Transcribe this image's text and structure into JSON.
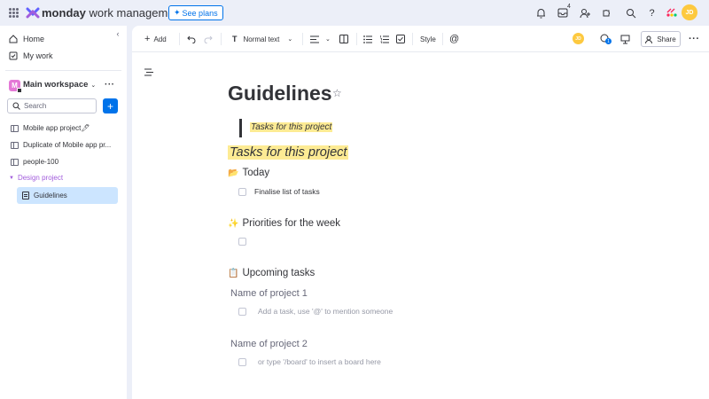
{
  "app": {
    "brand_bold": "monday",
    "brand_rest": " work management",
    "see_plans": "See plans",
    "inbox_count": "4",
    "avatar_initials": "JD"
  },
  "sidebar": {
    "home": "Home",
    "my_work": "My work",
    "workspace_initial": "M",
    "workspace_name": "Main workspace",
    "search_placeholder": "Search",
    "boards": [
      {
        "label": "Mobile app project🖊"
      },
      {
        "label": "Duplicate of Mobile app pr..."
      },
      {
        "label": "people-100"
      }
    ],
    "folder": "Design project",
    "selected_doc": "Guidelines"
  },
  "toolbar": {
    "add": "Add",
    "text_style": "Normal text",
    "style": "Style",
    "share": "Share",
    "avatar_initials": "JD",
    "updates_count": "1"
  },
  "doc": {
    "title": "Guidelines",
    "quote": "Tasks for this project",
    "heading": "Tasks for this project",
    "sections": [
      {
        "emoji": "📂",
        "title": "Today"
      },
      {
        "emoji": "✨",
        "title": "Priorities for the week"
      },
      {
        "emoji": "📋",
        "title": "Upcoming tasks"
      }
    ],
    "today_task": "Finalise list of tasks",
    "project1": "Name of project 1",
    "project1_placeholder": "Add a task, use '@' to mention someone",
    "project2": "Name of project 2",
    "project2_placeholder": "or type '/board' to insert a board here"
  },
  "colors": {
    "accent": "#0073ea",
    "highlight": "#fdeb94",
    "folder": "#a25ddc",
    "avatar": "#fdc93f",
    "selected": "#cce5ff"
  }
}
